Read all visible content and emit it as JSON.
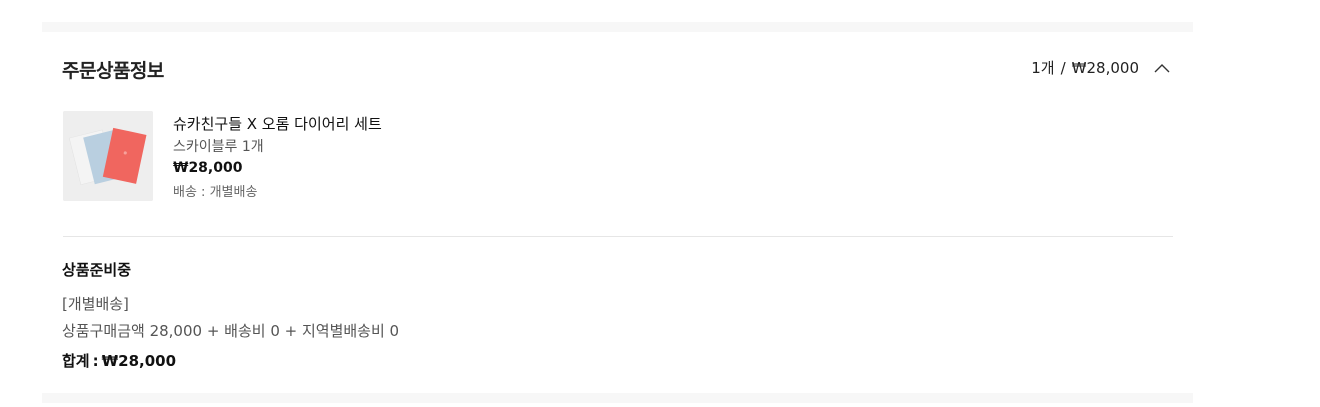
{
  "order_items": {
    "title": "주문상품정보",
    "summary_count": "1개",
    "summary_separator": "/",
    "summary_total": "₩28,000",
    "toggle_icon": "chevron-up-icon"
  },
  "product": {
    "name": "슈카친구들 X 오롬 다이어리 세트",
    "option": "스카이블루 1개",
    "price": "₩28,000",
    "shipping": "배송 : 개별배송",
    "thumbnail_colors": {
      "background": "#eeeeee",
      "notebook_white": "#f4f4f4",
      "notebook_blue": "#b9cfe0",
      "notebook_coral": "#f0665f"
    }
  },
  "shipment": {
    "status": "상품준비중",
    "type": "[개별배송]",
    "breakdown": "상품구매금액 28,000 + 배송비 0 + 지역별배송비 0",
    "total_label": "합계",
    "total_colon": ":",
    "total_value": "₩28,000"
  }
}
